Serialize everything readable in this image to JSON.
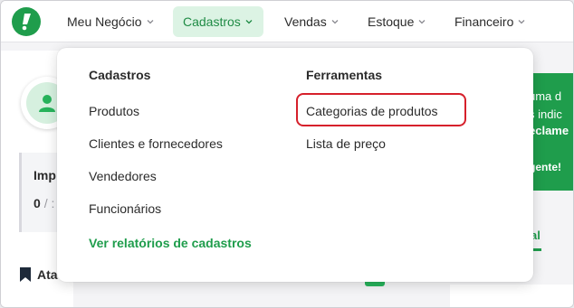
{
  "nav": {
    "items": [
      {
        "label": "Meu Negócio"
      },
      {
        "label": "Cadastros"
      },
      {
        "label": "Vendas"
      },
      {
        "label": "Estoque"
      },
      {
        "label": "Financeiro"
      }
    ]
  },
  "dropdown": {
    "cadastros_title": "Cadastros",
    "cadastros_items": [
      "Produtos",
      "Clientes e fornecedores",
      "Vendedores",
      "Funcionários"
    ],
    "report_link": "Ver relatórios de cadastros",
    "ferramentas_title": "Ferramentas",
    "ferramentas_items": [
      "Categorias de produtos",
      "Lista de preço"
    ]
  },
  "background": {
    "imp_label": "Imp",
    "imp_value": "0",
    "imp_sep": "/ :",
    "ata_label": "Ata",
    "promo_lines": [
      "uma d",
      "s indic",
      "eclame",
      "gente!"
    ],
    "tab_partial": "al"
  },
  "colors": {
    "brand_green": "#1f9d4c",
    "active_bg": "#dcf3e4",
    "highlight_red": "#d6202b"
  }
}
